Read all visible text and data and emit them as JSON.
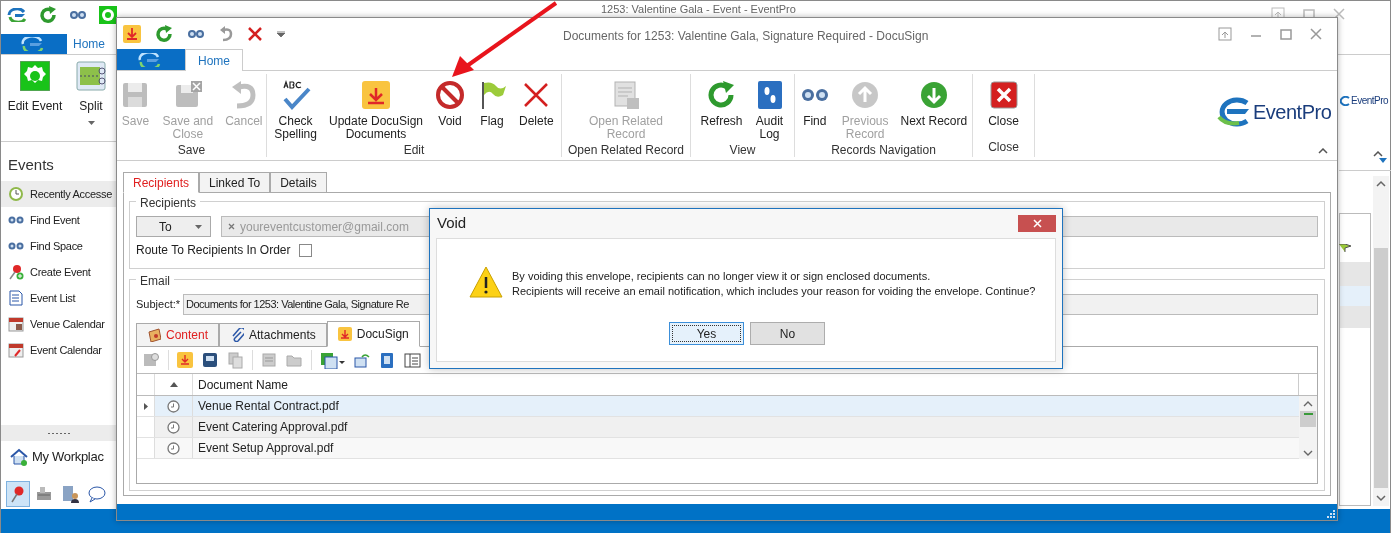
{
  "main_window": {
    "title": "1253: Valentine Gala - Event - EventPro",
    "ribbon_tab": "Home",
    "ribbon_buttons": [
      {
        "label": "Edit Event"
      },
      {
        "label": "Split"
      }
    ],
    "navigation": {
      "header": "Events",
      "items": [
        {
          "label": "Recently Accesse",
          "selected": true
        },
        {
          "label": "Find Event",
          "selected": false
        },
        {
          "label": "Find Space",
          "selected": false
        },
        {
          "label": "Create Event",
          "selected": false
        },
        {
          "label": "Event List",
          "selected": false
        },
        {
          "label": "Venue Calendar",
          "selected": false
        },
        {
          "label": "Event Calendar",
          "selected": false
        }
      ],
      "workplace": "My Workplac",
      "pane_buttons": [
        {
          "selected": true
        },
        {
          "selected": false
        },
        {
          "selected": false
        },
        {
          "selected": false
        }
      ]
    },
    "logo": "EventPro"
  },
  "document_window": {
    "title": "Documents for 1253: Valentine Gala, Signature Required - DocuSign",
    "ribbon_tab": "Home",
    "groups": [
      {
        "label": "Save",
        "buttons": [
          {
            "label": "Save",
            "disabled": true
          },
          {
            "label": "Save and\nClose",
            "disabled": true
          },
          {
            "label": "Cancel",
            "disabled": true
          }
        ]
      },
      {
        "label": "Edit",
        "buttons": [
          {
            "label": "Check\nSpelling",
            "disabled": false
          },
          {
            "label": "Update DocuSign\nDocuments",
            "disabled": false
          },
          {
            "label": "Void",
            "disabled": false
          },
          {
            "label": "Flag",
            "disabled": false
          },
          {
            "label": "Delete",
            "disabled": false
          }
        ]
      },
      {
        "label": "Open Related Record",
        "buttons": [
          {
            "label": "Open Related\nRecord",
            "disabled": true
          }
        ]
      },
      {
        "label": "View",
        "buttons": [
          {
            "label": "Refresh",
            "disabled": false
          },
          {
            "label": "Audit\nLog",
            "disabled": false
          }
        ]
      },
      {
        "label": "Records Navigation",
        "buttons": [
          {
            "label": "Find",
            "disabled": false
          },
          {
            "label": "Previous\nRecord",
            "disabled": true
          },
          {
            "label": "Next Record",
            "disabled": false
          }
        ]
      },
      {
        "label": "Close",
        "buttons": [
          {
            "label": "Close",
            "disabled": false
          }
        ]
      }
    ],
    "logo": "EventPro",
    "tabs": [
      {
        "label": "Recipients",
        "selected": true,
        "alert": true
      },
      {
        "label": "Linked To",
        "selected": false,
        "alert": false
      },
      {
        "label": "Details",
        "selected": false,
        "alert": false
      }
    ],
    "recipients": {
      "legend": "Recipients",
      "type": "To",
      "recipient": "youreventcustomer@gmail.com",
      "route_label": "Route To Recipients In Order",
      "route_checked": false
    },
    "email": {
      "legend": "Email",
      "subject_label": "Subject:*",
      "subject": "Documents for 1253: Valentine Gala, Signature Re",
      "tabs": [
        {
          "label": "Content",
          "selected": false,
          "alert": true
        },
        {
          "label": "Attachments",
          "selected": false,
          "alert": false
        },
        {
          "label": "DocuSign",
          "selected": true,
          "alert": false
        }
      ],
      "grid": {
        "column": "Document Name",
        "rows": [
          {
            "name": "Venue Rental Contract.pdf",
            "focused": true
          },
          {
            "name": "Event Catering Approval.pdf",
            "focused": false
          },
          {
            "name": "Event Setup Approval.pdf",
            "focused": false
          }
        ]
      }
    }
  },
  "dialog": {
    "title": "Void",
    "message": [
      "By voiding this envelope, recipients can no longer view it or sign enclosed documents.",
      "Recipients will receive an email notification, which includes your reason for voiding the envelope. Continue?"
    ],
    "buttons": [
      {
        "label": "Yes",
        "focused": true
      },
      {
        "label": "No",
        "focused": false
      }
    ]
  }
}
